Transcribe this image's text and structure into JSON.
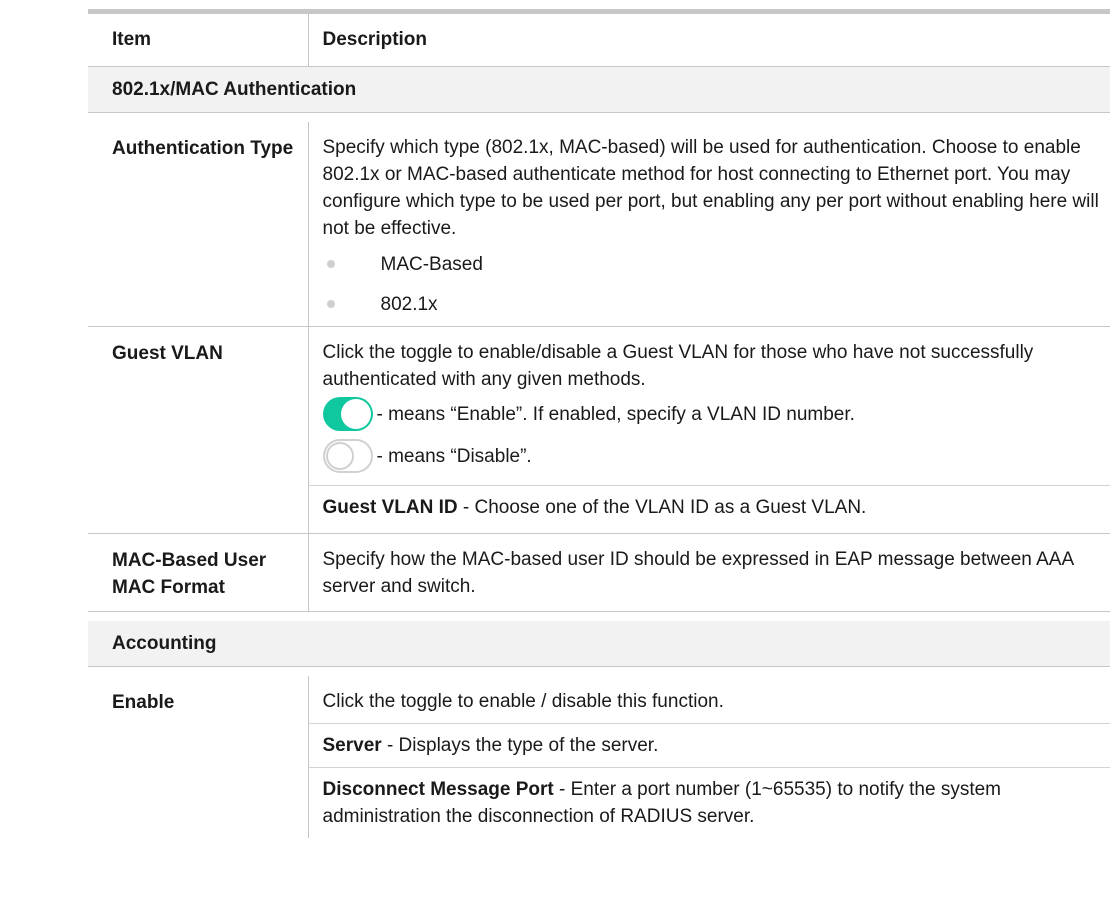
{
  "header": {
    "item": "Item",
    "description": "Description"
  },
  "sections": {
    "auth": {
      "title": "802.1x/MAC Authentication"
    },
    "accounting": {
      "title": "Accounting"
    }
  },
  "rows": {
    "auth_type": {
      "item": "Authentication Type",
      "desc": "Specify which type (802.1x, MAC-based) will be used for authentication. Choose to enable 802.1x or MAC-based authenticate method for host connecting to Ethernet port. You may configure which type to be used per port, but enabling any per port without enabling here will not be effective.",
      "options": [
        "MAC-Based",
        "802.1x"
      ]
    },
    "guest_vlan": {
      "item": "Guest VLAN",
      "desc": "Click the toggle to enable/disable a Guest VLAN for those who have not successfully authenticated with any given methods.",
      "toggle_on_text": "- means “Enable”. If enabled, specify a VLAN ID number.",
      "toggle_off_text": "- means “Disable”.",
      "vlan_id_label": "Guest VLAN ID",
      "vlan_id_text": " - Choose one of the VLAN ID as a Guest VLAN."
    },
    "mac_format": {
      "item": "MAC-Based User MAC Format",
      "desc": "Specify how the MAC-based user ID should be expressed in EAP message between AAA server and switch."
    },
    "enable": {
      "item": "Enable",
      "desc": "Click the toggle to enable / disable this function.",
      "server_label": "Server",
      "server_text": " - Displays the type of the server.",
      "port_label": "Disconnect Message Port",
      "port_text": " - Enter a port number (1~65535) to notify the system administration the disconnection of RADIUS server."
    }
  },
  "colors": {
    "toggle_on": "#10c8a0",
    "toggle_off_border": "#d0d0d0",
    "section_bg": "#f2f2f2",
    "rule": "#c7c7c7"
  },
  "icons": {
    "toggle_on": "toggle-on-icon",
    "toggle_off": "toggle-off-icon",
    "bullet": "bullet-dot-icon"
  }
}
